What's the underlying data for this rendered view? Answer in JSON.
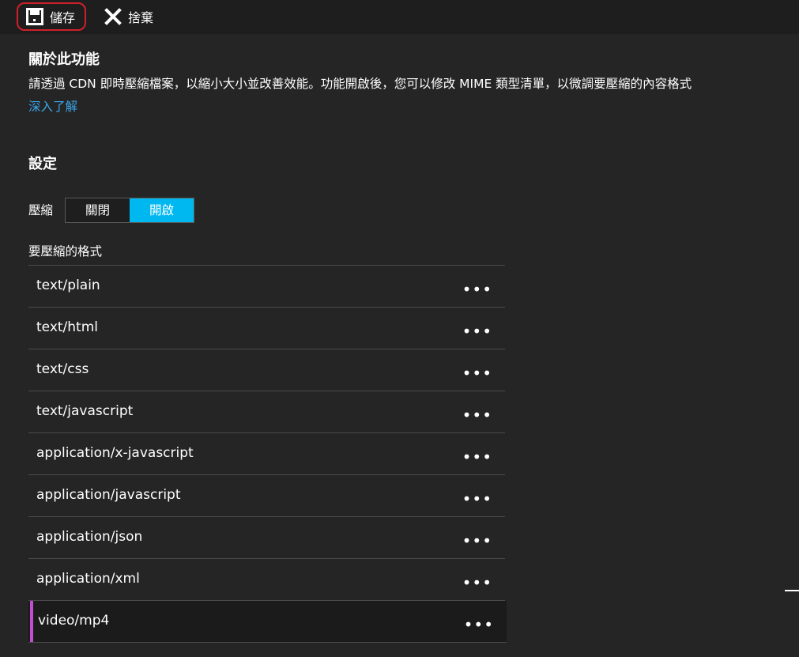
{
  "toolbar": {
    "save_label": "儲存",
    "discard_label": "捨棄"
  },
  "about": {
    "title": "關於此功能",
    "description": "請透過 CDN 即時壓縮檔案，以縮小大小並改善效能。功能開啟後，您可以修改 MIME 類型清單，以微調要壓縮的內容格式",
    "learn_more": "深入了解"
  },
  "settings": {
    "title": "設定",
    "compression_label": "壓縮",
    "toggle": {
      "off_label": "關閉",
      "on_label": "開啟",
      "selected": "開啟"
    },
    "formats_label": "要壓縮的格式",
    "formats": [
      "text/plain",
      "text/html",
      "text/css",
      "text/javascript",
      "application/x-javascript",
      "application/javascript",
      "application/json",
      "application/xml",
      "video/mp4"
    ],
    "more_label": "•••"
  },
  "colors": {
    "accent": "#00b8f0",
    "highlight_border": "#d0202a",
    "edit_marker": "#c04fcf",
    "link": "#3aa6e8"
  }
}
